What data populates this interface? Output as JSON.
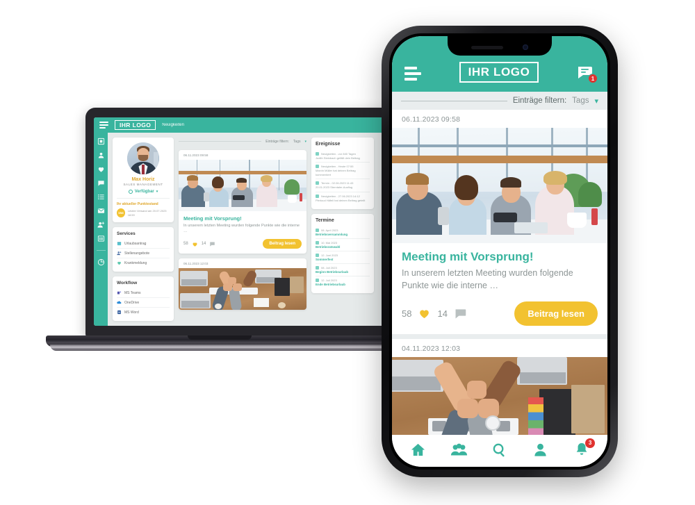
{
  "brand": {
    "primary": "#39b49e",
    "accent": "#f2c230",
    "badge_red": "#e0322f"
  },
  "desktop": {
    "logo": "IHR LOGO",
    "nav_item": "Neuigkeiten",
    "sidebar_icons": [
      "dashboard-icon",
      "user-icon",
      "heart-icon",
      "chat-icon",
      "list-icon",
      "mail-icon",
      "add-user-icon",
      "grid-icon",
      "logout-icon"
    ],
    "profile": {
      "name": "Max Horiz",
      "role": "SALES MANAGEMENT",
      "status": "Verfügbar",
      "points_title": "Ihr aktueller Punktestand",
      "points_value": "154",
      "points_sub": "Letzter Versand am 20.07.2023 18:59"
    },
    "services": {
      "title": "Services",
      "items": [
        {
          "label": "Urlaubsantrag",
          "icon": "calendar-icon"
        },
        {
          "label": "Stellenangebote",
          "icon": "add-user-icon"
        },
        {
          "label": "Krankmeldung",
          "icon": "health-icon"
        }
      ]
    },
    "workflow": {
      "title": "Workflow",
      "items": [
        {
          "label": "MS Teams",
          "icon": "teams-icon"
        },
        {
          "label": "OneDrive",
          "icon": "onedrive-icon"
        },
        {
          "label": "MS Word",
          "icon": "word-icon"
        }
      ]
    },
    "filter": {
      "label": "Einträge filtern:",
      "value": "Tags"
    },
    "posts": [
      {
        "time": "06.11.2023 09:58",
        "title": "Meeting mit Vorsprung!",
        "text": "In unserem letzten Meeting wurden folgende Punkte wie die interne …",
        "likes": "58",
        "comments": "14",
        "cta": "Beitrag lesen"
      },
      {
        "time": "06.11.2023 12:03"
      }
    ],
    "events": {
      "title": "Ereignisse",
      "items": [
        {
          "head": "Neuigkeiten - vor 840 Tagen",
          "detail": "Judith Steinbach gefällt dein Beitrag"
        },
        {
          "head": "Neuigkeiten - Heute 07:55",
          "detail": "Marvin Müller hat deinen Beitrag kommentiert"
        },
        {
          "head": "Termin - 02.06.2023 11:43",
          "detail": "20.01.2023 Sterntaler-Ausflug"
        },
        {
          "head": "Neuigkeiten - 27.06.2023 14:12",
          "detail": "Pierloud Häfeli hat deinen Beitrag geteilt"
        }
      ]
    },
    "appointments": {
      "title": "Termine",
      "items": [
        {
          "date": "08. April 2023",
          "title": "Betriebsversammlung"
        },
        {
          "date": "10. Mai 2023",
          "title": "Betriebsratswahl"
        },
        {
          "date": "12. Juni 2023",
          "title": "Sommerfest"
        },
        {
          "date": "08. Juli 2023",
          "title": "Beginn Betriebsurlaub"
        },
        {
          "date": "12. Juli 2023",
          "title": "Ende Betriebsurlaub"
        }
      ]
    }
  },
  "mobile": {
    "logo": "IHR LOGO",
    "chat_badge": "1",
    "filter": {
      "label": "Einträge filtern:",
      "value": "Tags"
    },
    "posts": [
      {
        "time": "06.11.2023  09:58",
        "title": "Meeting mit Vorsprung!",
        "text": "In unserem letzten Meeting wurden folgende Punkte wie die interne …",
        "likes": "58",
        "comments": "14",
        "cta": "Beitrag lesen"
      },
      {
        "time": "04.11.2023  12:03"
      }
    ],
    "nav": [
      {
        "icon": "home-icon",
        "badge": ""
      },
      {
        "icon": "people-icon",
        "badge": ""
      },
      {
        "icon": "search-icon",
        "badge": ""
      },
      {
        "icon": "person-icon",
        "badge": ""
      },
      {
        "icon": "bell-icon",
        "badge": "3"
      }
    ]
  }
}
